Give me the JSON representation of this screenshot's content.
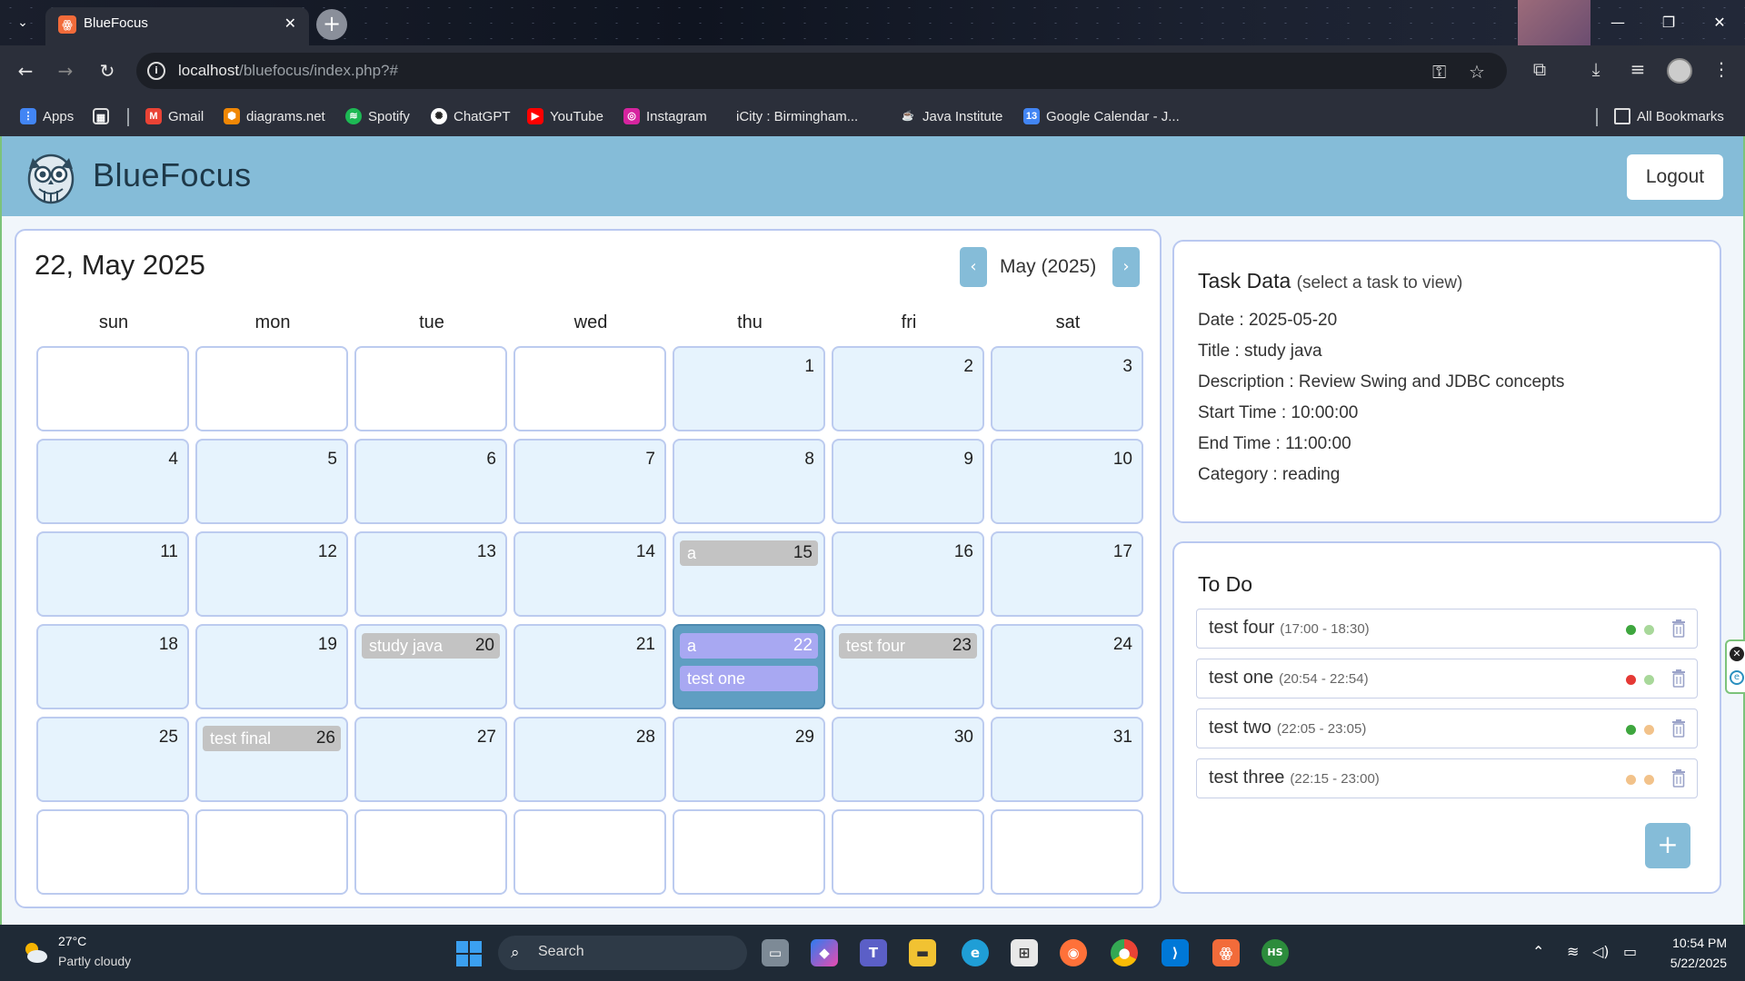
{
  "browser": {
    "tab_title": "BlueFocus",
    "url_host": "localhost",
    "url_path": "/bluefocus/index.php?#",
    "bookmarks": [
      {
        "label": "Apps",
        "color": "#4285f4"
      },
      {
        "label": "Gmail",
        "color": "#ea4335"
      },
      {
        "label": "diagrams.net",
        "color": "#f08705"
      },
      {
        "label": "Spotify",
        "color": "#1db954"
      },
      {
        "label": "ChatGPT",
        "color": "#2b2f3a"
      },
      {
        "label": "YouTube",
        "color": "#ff0000"
      },
      {
        "label": "Instagram",
        "color": "#d6249f"
      },
      {
        "label": "iCity : Birmingham...",
        "color": "#2b2f3a"
      },
      {
        "label": "Java Institute",
        "color": "#c0392b"
      },
      {
        "label": "Google Calendar - J...",
        "color": "#4285f4"
      }
    ],
    "all_bookmarks": "All Bookmarks"
  },
  "app": {
    "brand": "BlueFocus",
    "logout": "Logout"
  },
  "calendar": {
    "selected_date": "22, May 2025",
    "month_label": "May (2025)",
    "weekdays": [
      "sun",
      "mon",
      "tue",
      "wed",
      "thu",
      "fri",
      "sat"
    ],
    "cells": [
      {
        "day": ""
      },
      {
        "day": ""
      },
      {
        "day": ""
      },
      {
        "day": ""
      },
      {
        "day": "1"
      },
      {
        "day": "2"
      },
      {
        "day": "3"
      },
      {
        "day": "4"
      },
      {
        "day": "5"
      },
      {
        "day": "6"
      },
      {
        "day": "7"
      },
      {
        "day": "8"
      },
      {
        "day": "9"
      },
      {
        "day": "10"
      },
      {
        "day": "11"
      },
      {
        "day": "12"
      },
      {
        "day": "13"
      },
      {
        "day": "14"
      },
      {
        "day": "15",
        "events": [
          "a"
        ]
      },
      {
        "day": "16"
      },
      {
        "day": "17"
      },
      {
        "day": "18"
      },
      {
        "day": "19"
      },
      {
        "day": "20",
        "events": [
          "study java"
        ]
      },
      {
        "day": "21"
      },
      {
        "day": "22",
        "events": [
          "a",
          "test one"
        ],
        "today": true
      },
      {
        "day": "23",
        "events": [
          "test four"
        ]
      },
      {
        "day": "24"
      },
      {
        "day": "25"
      },
      {
        "day": "26",
        "events": [
          "test final"
        ]
      },
      {
        "day": "27"
      },
      {
        "day": "28"
      },
      {
        "day": "29"
      },
      {
        "day": "30"
      },
      {
        "day": "31"
      },
      {
        "day": ""
      },
      {
        "day": ""
      },
      {
        "day": ""
      },
      {
        "day": ""
      },
      {
        "day": ""
      },
      {
        "day": ""
      },
      {
        "day": ""
      }
    ]
  },
  "task_data": {
    "title": "Task Data",
    "subtitle": "(select a task to view)",
    "date": "Date : 2025-05-20",
    "task_title": "Title : study java",
    "description": "Description : Review Swing and JDBC concepts",
    "start_time": "Start Time : 10:00:00",
    "end_time": "End Time : 11:00:00",
    "category": "Category : reading"
  },
  "todo": {
    "title": "To Do",
    "add_label": "+",
    "items": [
      {
        "name": "test four",
        "time": "(17:00 - 18:30)",
        "dot1": "#3ea63e",
        "dot2": "#a8d89a"
      },
      {
        "name": "test one",
        "time": "(20:54 - 22:54)",
        "dot1": "#e53935",
        "dot2": "#a8d89a"
      },
      {
        "name": "test two",
        "time": "(22:05 - 23:05)",
        "dot1": "#3ea63e",
        "dot2": "#f2c28a"
      },
      {
        "name": "test three",
        "time": "(22:15 - 23:00)",
        "dot1": "#f2c28a",
        "dot2": "#f2c28a"
      }
    ]
  },
  "taskbar": {
    "temperature": "27°C",
    "weather": "Partly cloudy",
    "search": "Search",
    "time": "10:54 PM",
    "date": "5/22/2025"
  }
}
